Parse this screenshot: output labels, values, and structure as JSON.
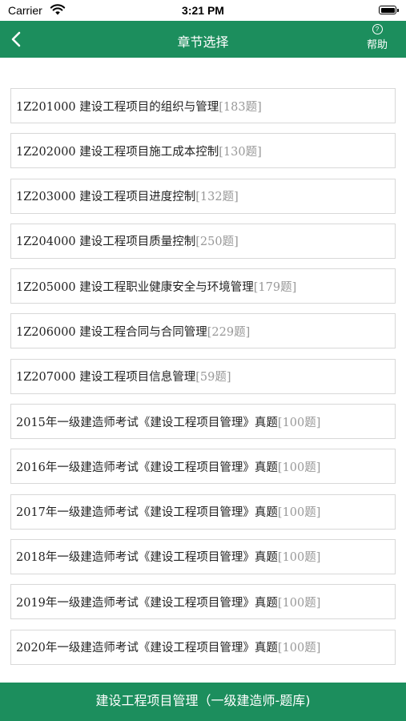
{
  "status_bar": {
    "carrier": "Carrier",
    "time": "3:21 PM"
  },
  "nav": {
    "title": "章节选择",
    "help_icon_glyph": "?",
    "help_label": "帮助",
    "color": "#1c8e5d"
  },
  "chapters": [
    {
      "title": "1Z201000 建设工程项目的组织与管理",
      "count": "[183题]"
    },
    {
      "title": "1Z202000 建设工程项目施工成本控制",
      "count": "[130题]"
    },
    {
      "title": "1Z203000 建设工程项目进度控制",
      "count": "[132题]"
    },
    {
      "title": "1Z204000 建设工程项目质量控制",
      "count": "[250题]"
    },
    {
      "title": "1Z205000 建设工程职业健康安全与环境管理",
      "count": "[179题]"
    },
    {
      "title": "1Z206000 建设工程合同与合同管理",
      "count": "[229题]"
    },
    {
      "title": "1Z207000 建设工程项目信息管理",
      "count": "[59题]"
    },
    {
      "title": "2015年一级建造师考试《建设工程项目管理》真题",
      "count": "[100题]"
    },
    {
      "title": "2016年一级建造师考试《建设工程项目管理》真题",
      "count": "[100题]"
    },
    {
      "title": "2017年一级建造师考试《建设工程项目管理》真题",
      "count": "[100题]"
    },
    {
      "title": "2018年一级建造师考试《建设工程项目管理》真题",
      "count": "[100题]"
    },
    {
      "title": "2019年一级建造师考试《建设工程项目管理》真题",
      "count": "[100题]"
    },
    {
      "title": "2020年一级建造师考试《建设工程项目管理》真题",
      "count": "[100题]"
    }
  ],
  "bottom_bar": {
    "label": "建设工程项目管理（一级建造师-题库)"
  }
}
